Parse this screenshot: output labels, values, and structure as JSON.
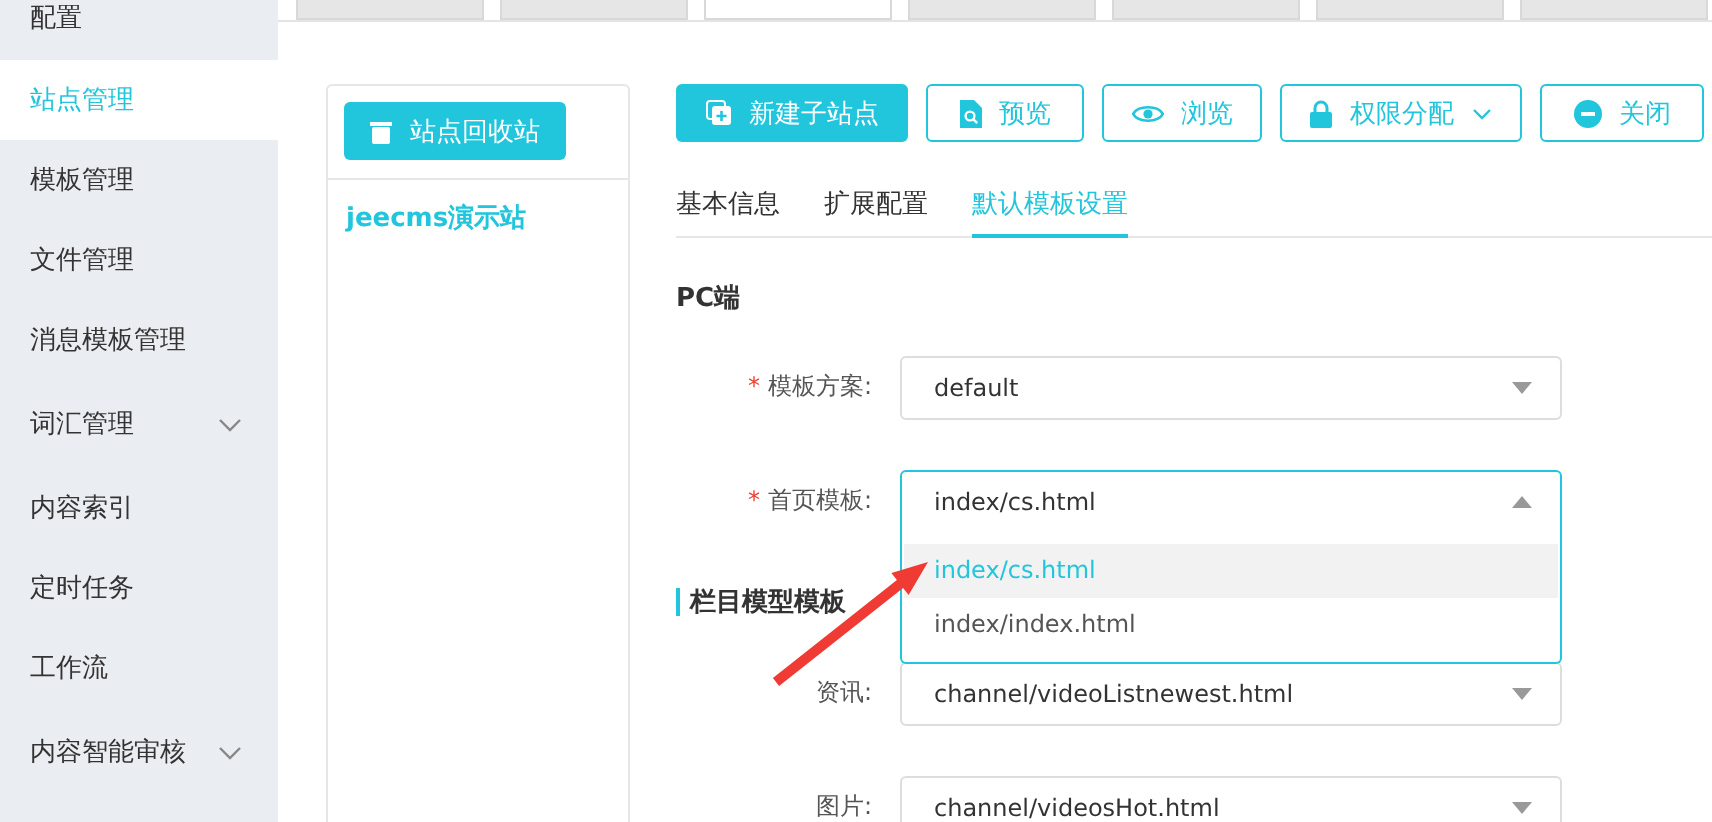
{
  "sidebar": {
    "items": [
      {
        "label": "配置",
        "selected": false,
        "expandable": false
      },
      {
        "label": "站点管理",
        "selected": true,
        "expandable": false
      },
      {
        "label": "模板管理",
        "selected": false,
        "expandable": false
      },
      {
        "label": "文件管理",
        "selected": false,
        "expandable": false
      },
      {
        "label": "消息模板管理",
        "selected": false,
        "expandable": false
      },
      {
        "label": "词汇管理",
        "selected": false,
        "expandable": true
      },
      {
        "label": "内容索引",
        "selected": false,
        "expandable": false
      },
      {
        "label": "定时任务",
        "selected": false,
        "expandable": false
      },
      {
        "label": "工作流",
        "selected": false,
        "expandable": false
      },
      {
        "label": "内容智能审核",
        "selected": false,
        "expandable": true
      }
    ]
  },
  "top_tabs": [
    {
      "selected": false
    },
    {
      "selected": false
    },
    {
      "selected": true
    },
    {
      "selected": false
    },
    {
      "selected": false
    },
    {
      "selected": false
    },
    {
      "selected": false
    }
  ],
  "site_panel": {
    "recycle_button": "站点回收站",
    "sites": [
      "jeecms演示站"
    ]
  },
  "toolbar": [
    {
      "label": "新建子站点",
      "kind": "primary"
    },
    {
      "label": "预览",
      "kind": "outline"
    },
    {
      "label": "浏览",
      "kind": "outline"
    },
    {
      "label": "权限分配",
      "kind": "dropdown"
    },
    {
      "label": "关闭",
      "kind": "outline"
    }
  ],
  "sub_tabs": [
    {
      "label": "基本信息",
      "selected": false
    },
    {
      "label": "扩展配置",
      "selected": false
    },
    {
      "label": "默认模板设置",
      "selected": true
    }
  ],
  "sections": [
    {
      "title": "PC端",
      "marked": false,
      "fields": [
        {
          "mark": "*",
          "label": "模板方案:",
          "value": "default",
          "open": false
        },
        {
          "mark": "*",
          "label": "首页模板:",
          "value": "index/cs.html",
          "open": true,
          "options": [
            {
              "label": "index/cs.html",
              "selected": true
            },
            {
              "label": "index/index.html",
              "selected": false
            }
          ]
        }
      ]
    },
    {
      "title": "栏目模型模板",
      "marked": true,
      "fields": [
        {
          "label": "资讯:",
          "value": "channel/videoListnewest.html",
          "open": false
        },
        {
          "label": "图片:",
          "value": "channel/videosHot.html",
          "open": false
        }
      ]
    }
  ]
}
